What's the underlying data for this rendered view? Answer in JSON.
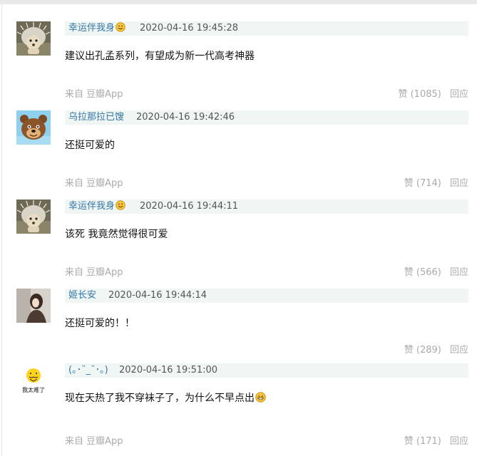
{
  "comments": [
    {
      "username": "幸运伴我身",
      "has_face_emoji": true,
      "time": "2020-04-16 19:45:28",
      "text": "建议出孔孟系列，有望成为新一代高考神器",
      "source": "来自 豆瓣App",
      "like": "赞 (1085)",
      "reply": "回应",
      "avatar_icon": "hedgehog-avatar-icon"
    },
    {
      "username": "乌拉那拉已馊",
      "has_face_emoji": false,
      "time": "2020-04-16 19:42:46",
      "text": "还挺可爱的",
      "source": "来自 豆瓣App",
      "like": "赞 (714)",
      "reply": "回应",
      "avatar_icon": "bear-avatar-icon"
    },
    {
      "username": "幸运伴我身",
      "has_face_emoji": true,
      "time": "2020-04-16 19:44:11",
      "text": "该死 我竟然觉得很可爱",
      "source": "来自 豆瓣App",
      "like": "赞 (566)",
      "reply": "回应",
      "avatar_icon": "hedgehog-avatar-icon"
    },
    {
      "username": "姬长安",
      "has_face_emoji": false,
      "time": "2020-04-16 19:44:14",
      "text": "还挺可爱的！！",
      "source": "",
      "like": "赞 (289)",
      "reply": "回应",
      "avatar_icon": "girl-avatar-icon"
    },
    {
      "username": "(｡･˘_˘･｡)",
      "has_face_emoji": false,
      "time": "2020-04-16 19:51:00",
      "text": "现在天热了我不穿袜子了，为什么不早点出",
      "source": "来自 豆瓣App",
      "like": "赞 (171)",
      "reply": "回应",
      "avatar_icon": "duck-avatar-icon",
      "avatar_caption": "我太难了"
    }
  ],
  "colors": {
    "username": "#3377aa",
    "header_bg": "#f0f6f3",
    "muted": "#aaaaaa"
  }
}
